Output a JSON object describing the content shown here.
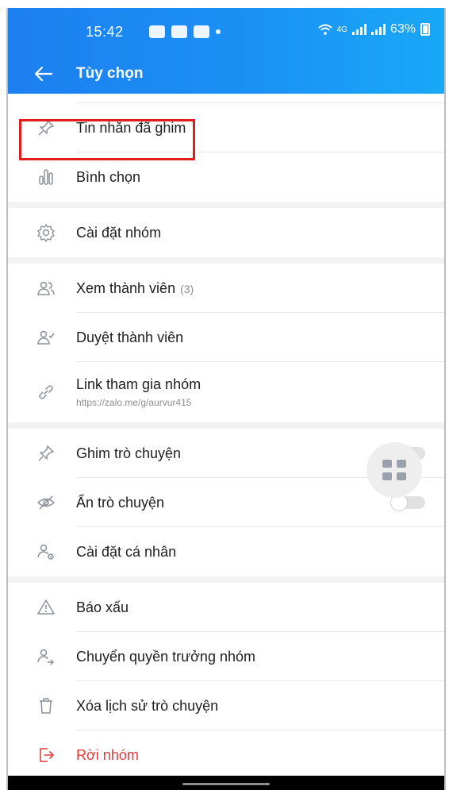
{
  "status": {
    "time": "15:42",
    "network": "4G",
    "battery": "63%"
  },
  "header": {
    "back_icon": "arrow-left-icon",
    "title": "Tùy chọn"
  },
  "menu": {
    "pinned_messages": "Tin nhắn đã ghim",
    "polls": "Bình chọn",
    "group_settings": "Cài đặt nhóm",
    "view_members": "Xem thành viên",
    "member_count": "(3)",
    "approve_members": "Duyệt thành viên",
    "group_link": "Link tham gia nhóm",
    "group_link_url": "https://zalo.me/g/aurvur415",
    "pin_chat": "Ghim trò chuyện",
    "hide_chat": "Ẩn trò chuyện",
    "personal_settings": "Cài đặt cá nhân",
    "report": "Báo xấu",
    "transfer_admin": "Chuyển quyền trưởng nhóm",
    "clear_history": "Xóa lịch sử trò chuyện",
    "leave_group": "Rời nhóm"
  },
  "toggles": {
    "pin_chat_on": false,
    "hide_chat_on": false
  },
  "colors": {
    "header_start": "#1d7ff0",
    "header_end": "#19a8f7",
    "danger": "#e43c3c",
    "highlight": "#e11d1d"
  }
}
